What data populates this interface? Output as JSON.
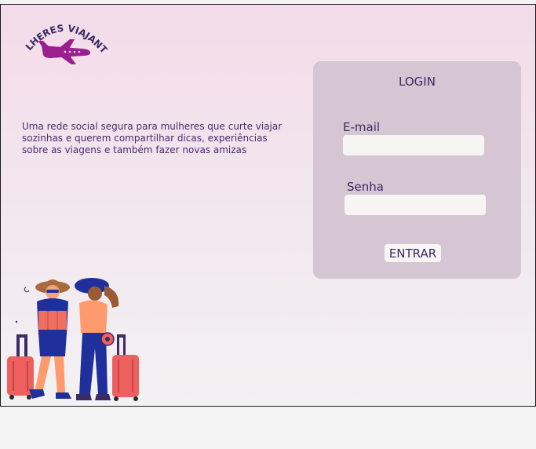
{
  "brand": {
    "name": "MULHERES VIAJANTES"
  },
  "tagline": {
    "lines": [
      "Uma rede social segura para mulheres que curte viajar",
      "sozinhas e querem  compartilhar dicas,  experiências",
      "sobre as viagens e também  fazer novas amizas"
    ]
  },
  "login": {
    "title": "LOGIN",
    "email_label": "E-mail",
    "email_value": "",
    "password_label": "Senha",
    "password_value": "",
    "submit_label": "ENTRAR"
  },
  "colors": {
    "brand_purple": "#9b1f8f",
    "text_dark": "#3b2a63",
    "card_bg": "#d6c5d2",
    "suitcase": "#ee5f5f",
    "outfit_blue": "#1f2f9c"
  },
  "icons": {
    "logo": "airplane-icon",
    "illustration": "two-women-travelers-with-suitcases"
  }
}
